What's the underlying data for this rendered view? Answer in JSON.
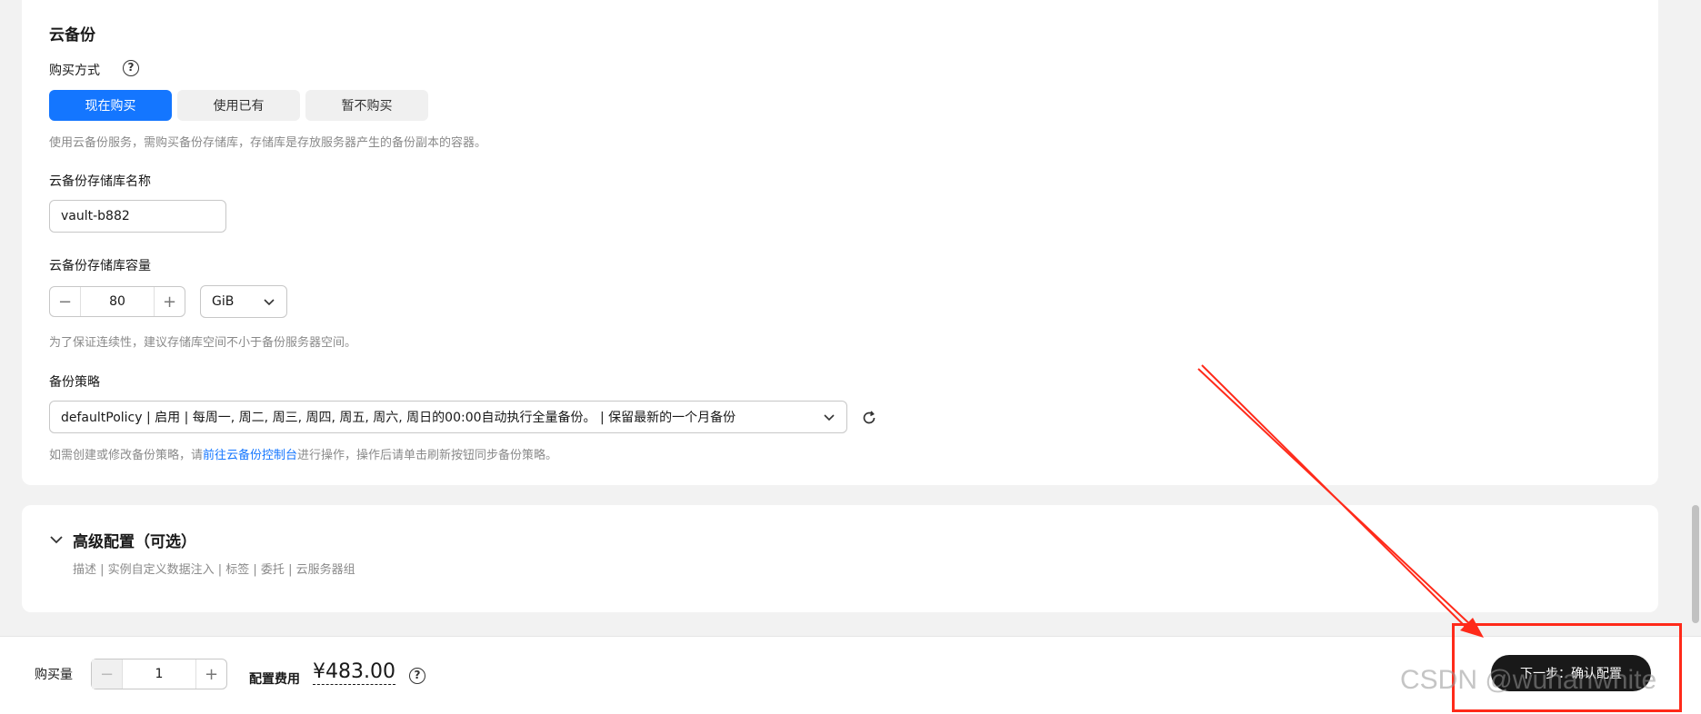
{
  "backup": {
    "title": "云备份",
    "purchase_label": "购买方式",
    "purchase_options": [
      {
        "label": "现在购买",
        "active": true
      },
      {
        "label": "使用已有",
        "active": false
      },
      {
        "label": "暂不购买",
        "active": false
      }
    ],
    "purchase_hint": "使用云备份服务，需购买备份存储库，存储库是存放服务器产生的备份副本的容器。",
    "vault_name_label": "云备份存储库名称",
    "vault_name_value": "vault-b882",
    "capacity_label": "云备份存储库容量",
    "capacity_value": "80",
    "capacity_unit": "GiB",
    "capacity_hint": "为了保证连续性，建议存储库空间不小于备份服务器空间。",
    "policy_label": "备份策略",
    "policy_value": "defaultPolicy | 启用 | 每周一, 周二, 周三, 周四, 周五, 周六, 周日的00:00自动执行全量备份。 | 保留最新的一个月备份",
    "policy_hint_prefix": "如需创建或修改备份策略，请",
    "policy_hint_link": "前往云备份控制台",
    "policy_hint_suffix": "进行操作，操作后请单击刷新按钮同步备份策略。"
  },
  "advanced": {
    "title": "高级配置（可选）",
    "subtitle": "描述 | 实例自定义数据注入 | 标签 | 委托 | 云服务器组"
  },
  "footer": {
    "quantity_label": "购买量",
    "quantity_value": "1",
    "fee_label": "配置费用",
    "fee_value": "¥483.00",
    "next_button": "下一步：确认配置"
  },
  "watermark": "CSDN @wuhanwhite",
  "colors": {
    "primary": "#1476ff",
    "dark_button": "#191919",
    "annotation": "#ff2a1a"
  }
}
